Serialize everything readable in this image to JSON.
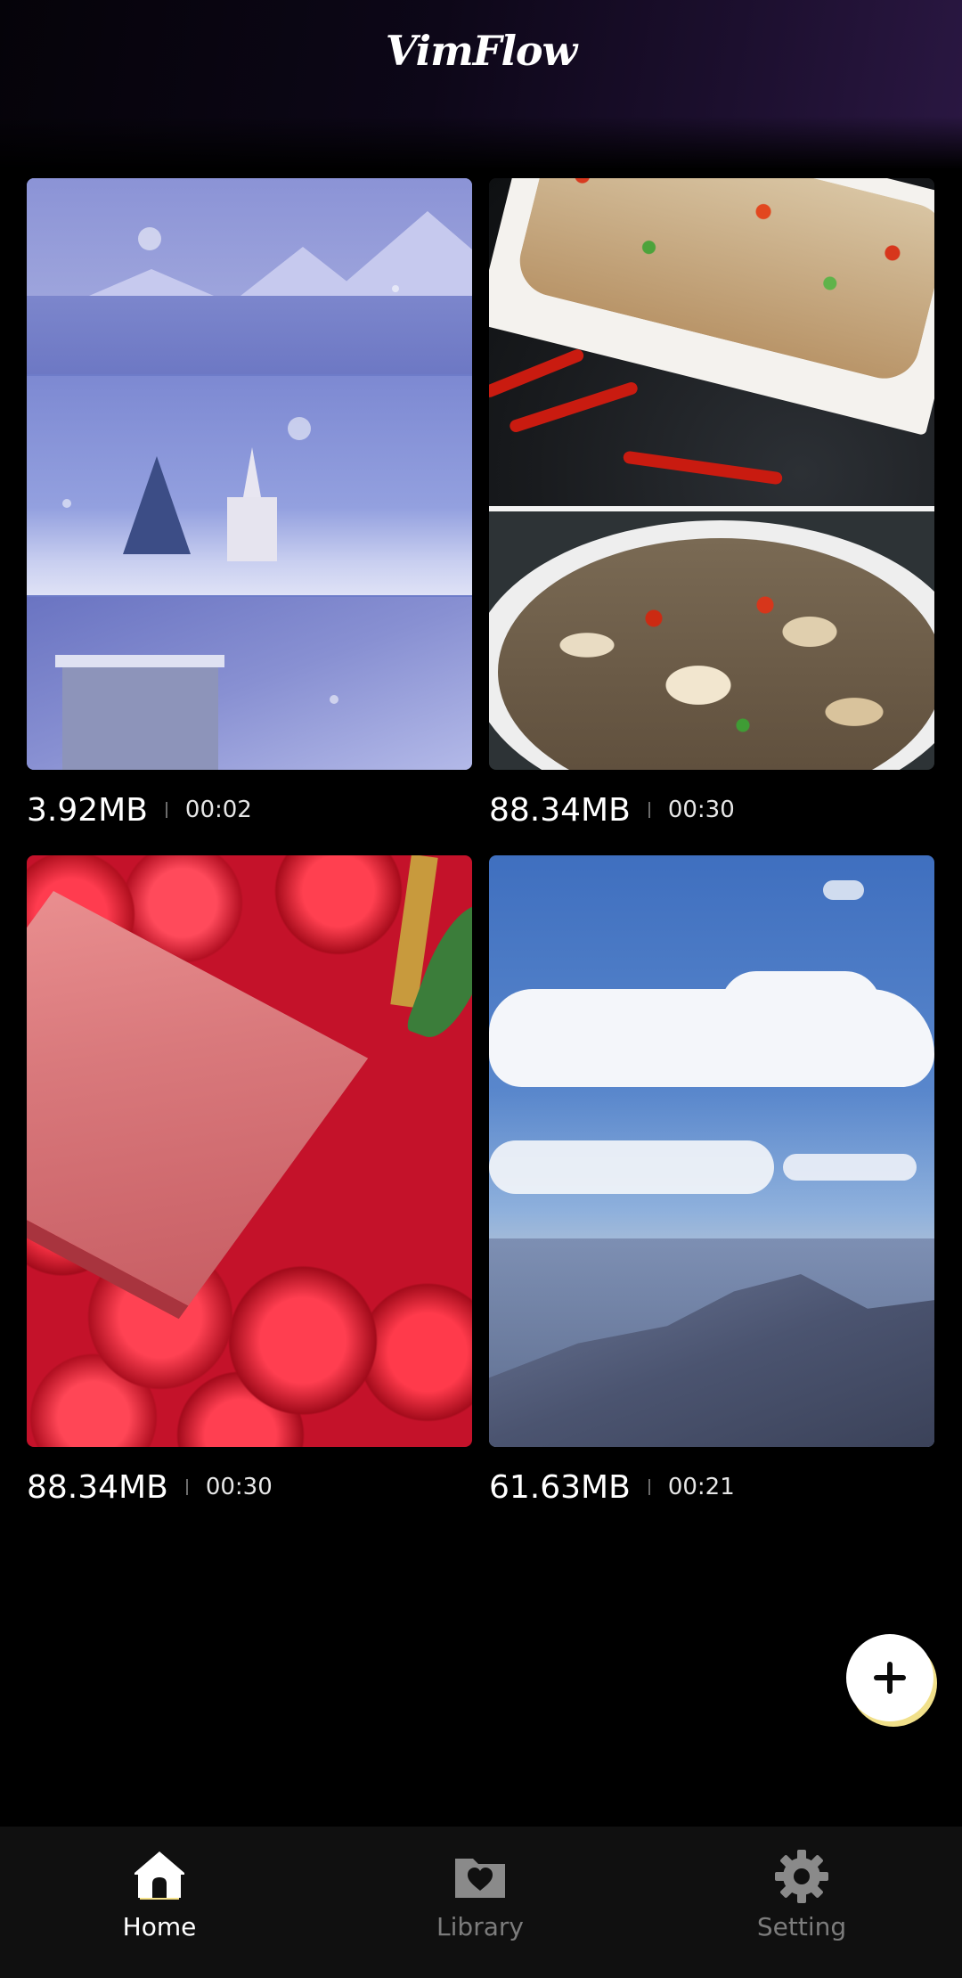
{
  "app": {
    "title": "VimFlow"
  },
  "videos": [
    {
      "size": "3.92MB",
      "duration": "00:02"
    },
    {
      "size": "88.34MB",
      "duration": "00:30"
    },
    {
      "size": "88.34MB",
      "duration": "00:30"
    },
    {
      "size": "61.63MB",
      "duration": "00:21"
    }
  ],
  "nav": {
    "items": [
      {
        "label": "Home",
        "icon": "home-icon",
        "active": true
      },
      {
        "label": "Library",
        "icon": "folder-heart-icon",
        "active": false
      },
      {
        "label": "Setting",
        "icon": "gear-icon",
        "active": false
      }
    ]
  },
  "fab": {
    "icon": "plus-icon"
  },
  "colors": {
    "background": "#000000",
    "active_nav": "#ffffff",
    "inactive_nav": "#7c7c7c",
    "home_icon_accent": "#f6e38a"
  }
}
